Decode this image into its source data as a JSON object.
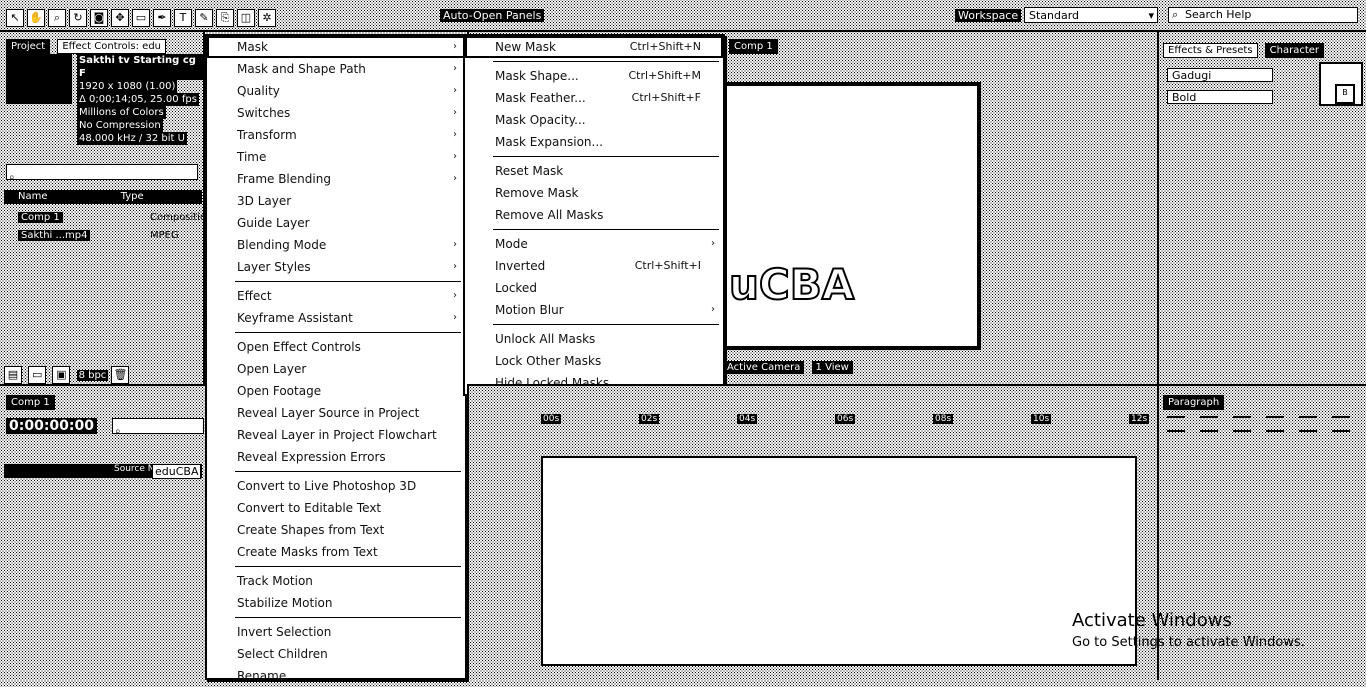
{
  "toolbar": {
    "tool_icons": [
      "selection-icon",
      "hand-icon",
      "zoom-icon",
      "rotate-icon",
      "camera-icon",
      "pan-icon",
      "mask-icon",
      "pen-icon",
      "text-icon",
      "brush-icon",
      "stamp-icon",
      "eraser-icon",
      "puppet-icon"
    ],
    "auto_open_panels": "Auto-Open Panels",
    "workspace_label": "Workspace",
    "workspace_value": "Standard",
    "search_help_placeholder": "Search Help"
  },
  "project": {
    "tabs": [
      "Project",
      "Effect Controls: edu"
    ],
    "comp_name": "Sakthi tv Starting cg F",
    "info": [
      "1920 x 1080 (1.00)",
      "Δ 0;00;14;05, 25.00 fps",
      "Millions of Colors",
      "No Compression",
      "48.000 kHz / 32 bit U"
    ],
    "col_name": "Name",
    "col_type": "Type",
    "items": [
      {
        "name": "Comp 1",
        "type": "Composition"
      },
      {
        "name": "Sakthi ...mp4",
        "type": "MPEG"
      }
    ],
    "bpc": "8 bpc"
  },
  "timeline": {
    "tab": "Comp 1",
    "timecode": "0:00:00:00",
    "layer_name": "eduCBA",
    "source_label": "Source Name",
    "ruler": [
      "00s",
      "02s",
      "04s",
      "06s",
      "08s",
      "10s",
      "12s"
    ]
  },
  "composition": {
    "tab": "Comp 1",
    "logo_text": "uCBA",
    "active_camera": "Active Camera",
    "view": "1 View"
  },
  "character": {
    "tabs": [
      "Effects & Presets",
      "Character"
    ],
    "font": "Gadugi",
    "style": "Bold",
    "swatch_label": "B"
  },
  "paragraph": {
    "tab": "Paragraph"
  },
  "watermark": {
    "line1": "Activate Windows",
    "line2": "Go to Settings to activate Windows."
  },
  "menu_main": [
    {
      "label": "Mask",
      "arrow": true,
      "highlight": true
    },
    {
      "label": "Mask and Shape Path",
      "arrow": true
    },
    {
      "label": "Quality",
      "arrow": true
    },
    {
      "label": "Switches",
      "arrow": true
    },
    {
      "label": "Transform",
      "arrow": true
    },
    {
      "label": "Time",
      "arrow": true
    },
    {
      "label": "Frame Blending",
      "arrow": true
    },
    {
      "label": "3D Layer"
    },
    {
      "label": "Guide Layer"
    },
    {
      "label": "Blending Mode",
      "arrow": true
    },
    {
      "label": "Layer Styles",
      "arrow": true
    },
    {
      "sep": true
    },
    {
      "label": "Effect",
      "arrow": true
    },
    {
      "label": "Keyframe Assistant",
      "arrow": true
    },
    {
      "sep": true
    },
    {
      "label": "Open Effect Controls"
    },
    {
      "label": "Open Layer"
    },
    {
      "label": "Open Footage"
    },
    {
      "label": "Reveal Layer Source in Project"
    },
    {
      "label": "Reveal Layer in Project Flowchart"
    },
    {
      "label": "Reveal Expression Errors"
    },
    {
      "sep": true
    },
    {
      "label": "Convert to Live Photoshop 3D"
    },
    {
      "label": "Convert to Editable Text"
    },
    {
      "label": "Create Shapes from Text"
    },
    {
      "label": "Create Masks from Text"
    },
    {
      "sep": true
    },
    {
      "label": "Track Motion"
    },
    {
      "label": "Stabilize Motion"
    },
    {
      "sep": true
    },
    {
      "label": "Invert Selection"
    },
    {
      "label": "Select Children"
    },
    {
      "label": "Rename"
    }
  ],
  "menu_sub": [
    {
      "label": "New Mask",
      "shortcut": "Ctrl+Shift+N",
      "highlight": true
    },
    {
      "sep": true
    },
    {
      "label": "Mask Shape...",
      "shortcut": "Ctrl+Shift+M"
    },
    {
      "label": "Mask Feather...",
      "shortcut": "Ctrl+Shift+F"
    },
    {
      "label": "Mask Opacity..."
    },
    {
      "label": "Mask Expansion..."
    },
    {
      "sep": true
    },
    {
      "label": "Reset Mask"
    },
    {
      "label": "Remove Mask"
    },
    {
      "label": "Remove All Masks"
    },
    {
      "sep": true
    },
    {
      "label": "Mode",
      "arrow": true
    },
    {
      "label": "Inverted",
      "shortcut": "Ctrl+Shift+I"
    },
    {
      "label": "Locked"
    },
    {
      "label": "Motion Blur",
      "arrow": true
    },
    {
      "sep": true
    },
    {
      "label": "Unlock All Masks"
    },
    {
      "label": "Lock Other Masks"
    },
    {
      "label": "Hide Locked Masks"
    }
  ]
}
